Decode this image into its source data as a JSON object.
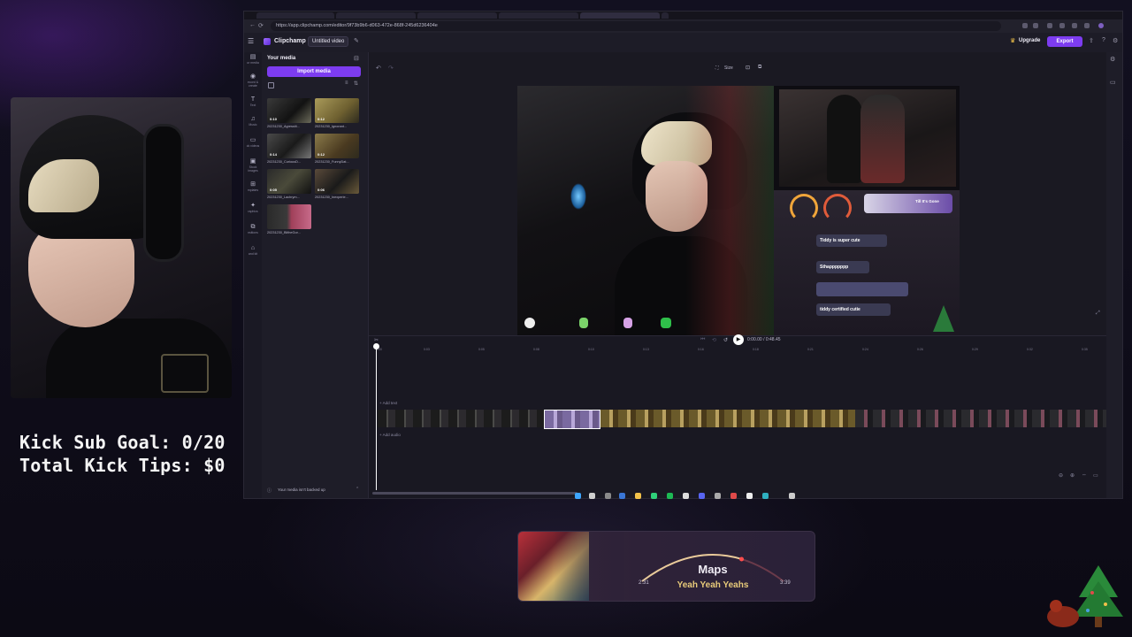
{
  "overlay": {
    "kick_sub_goal": "Kick Sub Goal: 0/20",
    "kick_tips": "Total Kick Tips: $0"
  },
  "browser": {
    "url": "https://app.clipchamp.com/editor/9f73b9b6-d063-472e-868f-245d6236404e"
  },
  "app": {
    "brand": "Clipchamp",
    "project_title": "Untitled video",
    "upgrade_label": "Upgrade",
    "export_label": "Export",
    "panel_title": "Your media",
    "import_label": "Import media",
    "backup_notice": "Your media isn't backed up",
    "size_label": "Size",
    "timecode": "0:00.00 / 0:48.45",
    "add_text": "+ Add text",
    "add_audio": "+ Add audio",
    "rail": [
      {
        "icon": "media-icon",
        "label": "ur media"
      },
      {
        "icon": "record-icon",
        "label": "ecord & create"
      },
      {
        "icon": "text-icon",
        "label": "Text"
      },
      {
        "icon": "music-icon",
        "label": "Music"
      },
      {
        "icon": "stock-icon",
        "label": "ck videos"
      },
      {
        "icon": "images-icon",
        "label": "Stock images"
      },
      {
        "icon": "templates-icon",
        "label": "mplates"
      },
      {
        "icon": "graphics-icon",
        "label": "raphics"
      },
      {
        "icon": "transitions-icon",
        "label": "nsitions"
      },
      {
        "icon": "brand-kit-icon",
        "label": "and kit"
      }
    ],
    "media": [
      {
        "name": "20231230_Agressiti...",
        "duration": "0:10"
      },
      {
        "name": "20231230_Ignorant...",
        "duration": "0:12"
      },
      {
        "name": "20231230_CuriousD...",
        "duration": "0:14"
      },
      {
        "name": "20231230_FunnyDat...",
        "duration": "0:12"
      },
      {
        "name": "20231230_Lachrym...",
        "duration": "0:05"
      },
      {
        "name": "20231230_Inexperie...",
        "duration": "0:06"
      },
      {
        "name": "20231230_BlitheGor...",
        "duration": ""
      }
    ],
    "ruler": [
      "0:00",
      "0:03",
      "0:05",
      "0:08",
      "0:10",
      "0:13",
      "0:16",
      "0:18",
      "0:21",
      "0:24",
      "0:26",
      "0:29",
      "0:32",
      "0:35",
      "0:37"
    ],
    "preview": {
      "chat": [
        "Tiddy is super cute",
        "Sthappppppp",
        "tiddy certified cutie"
      ],
      "banner": "Till It's Gone"
    }
  },
  "music": {
    "title": "Maps",
    "artist": "Yeah Yeah Yeahs",
    "elapsed": "2:31",
    "total": "3:39",
    "progress": 0.69
  }
}
